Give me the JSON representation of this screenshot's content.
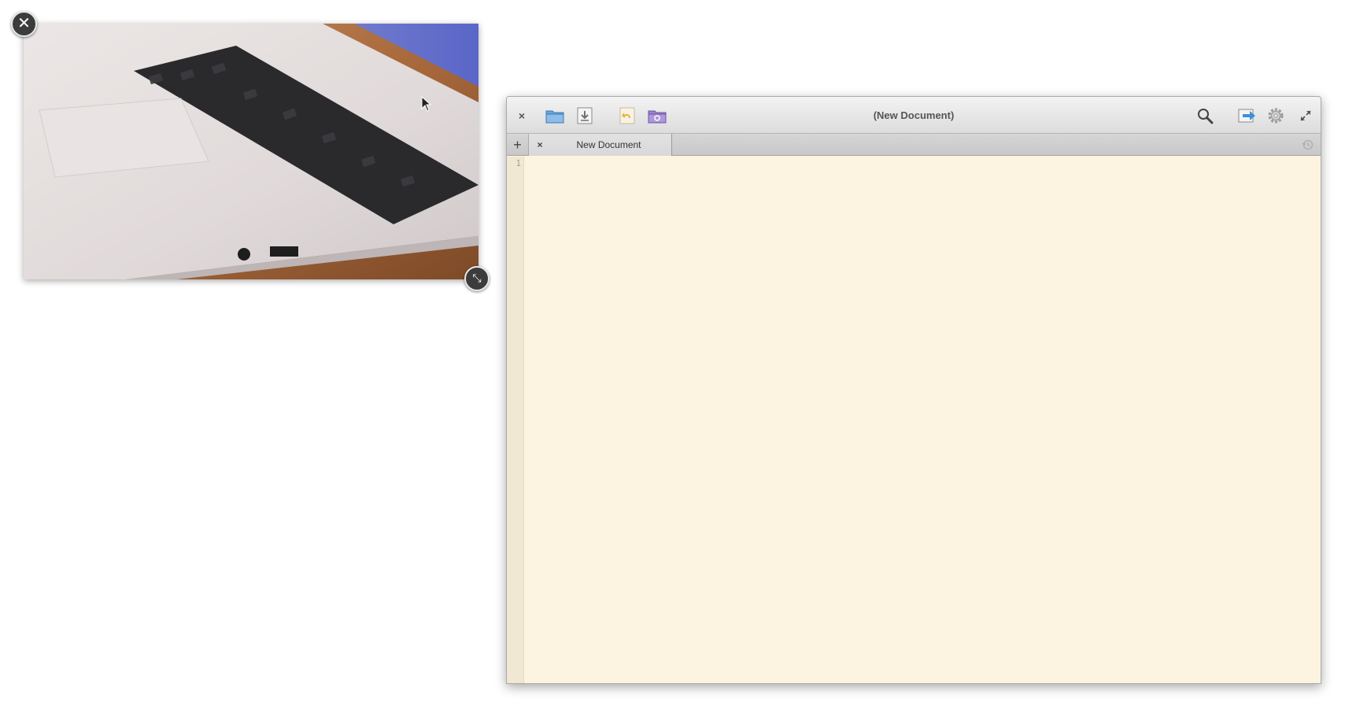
{
  "pip": {
    "close_symbol": "✕",
    "resize_symbol": "⤡"
  },
  "editor": {
    "title": "(New Document)",
    "close_symbol": "×",
    "toolbar": {
      "open_icon": "folder-open-icon",
      "save_icon": "document-save-icon",
      "revert_icon": "document-revert-icon",
      "project_icon": "folder-project-icon",
      "search_icon": "search-icon",
      "share_icon": "share-export-icon",
      "settings_icon": "gear-icon",
      "fullscreen_icon": "fullscreen-icon"
    },
    "tabbar": {
      "new_tab_symbol": "+",
      "tabs": [
        {
          "label": "New Document",
          "close_symbol": "×"
        }
      ],
      "history_icon": "history-icon"
    },
    "document": {
      "line_numbers": [
        "1"
      ],
      "text": ""
    },
    "colors": {
      "background": "#fcf4e0",
      "gutter": "#f0e8d2",
      "accent_blue": "#3d8fd6",
      "accent_purple": "#8a6fc2"
    }
  }
}
